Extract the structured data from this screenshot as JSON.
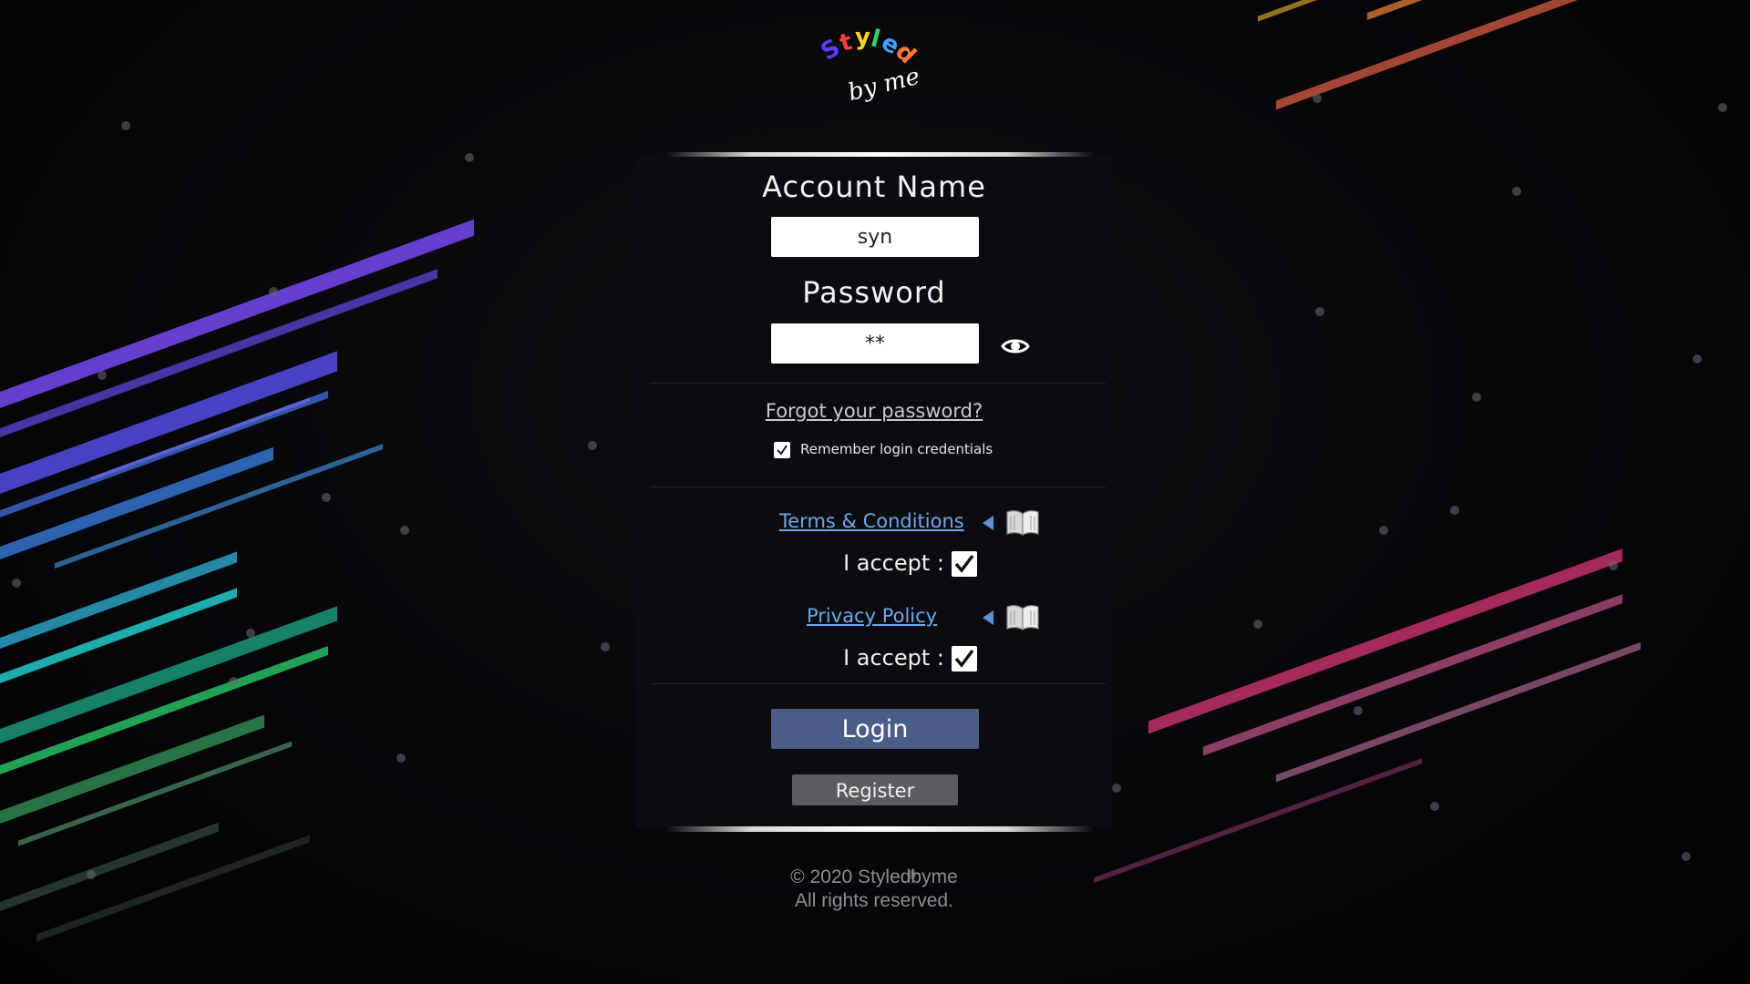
{
  "app": {
    "logo_top": "Styled",
    "logo_bottom": "by me"
  },
  "form": {
    "account_label": "Account Name",
    "account_value": "syn",
    "password_label": "Password",
    "password_value": "**",
    "forgot_link": "Forgot your password?",
    "remember_label": "Remember login credentials",
    "remember_checked": true,
    "terms_link": "Terms & Conditions",
    "terms_accept_label": "I accept :",
    "terms_checked": true,
    "privacy_link": "Privacy Policy",
    "privacy_accept_label": "I accept :",
    "privacy_checked": true,
    "login_label": "Login",
    "register_label": "Register"
  },
  "footer": {
    "copyright": "© 2020 Styledbyme",
    "rights": "All rights reserved."
  },
  "icons": {
    "password_toggle": "eye-icon",
    "terms_arrow": "triangle-left-icon",
    "terms_book": "book-icon",
    "privacy_arrow": "triangle-left-icon",
    "privacy_book": "book-icon",
    "remember_check": "checkmark-icon"
  },
  "colors": {
    "link": "#6fa8e8",
    "login_button": "#4a5d86",
    "register_button": "#5b5c5f",
    "panel": "#0b0c10"
  }
}
